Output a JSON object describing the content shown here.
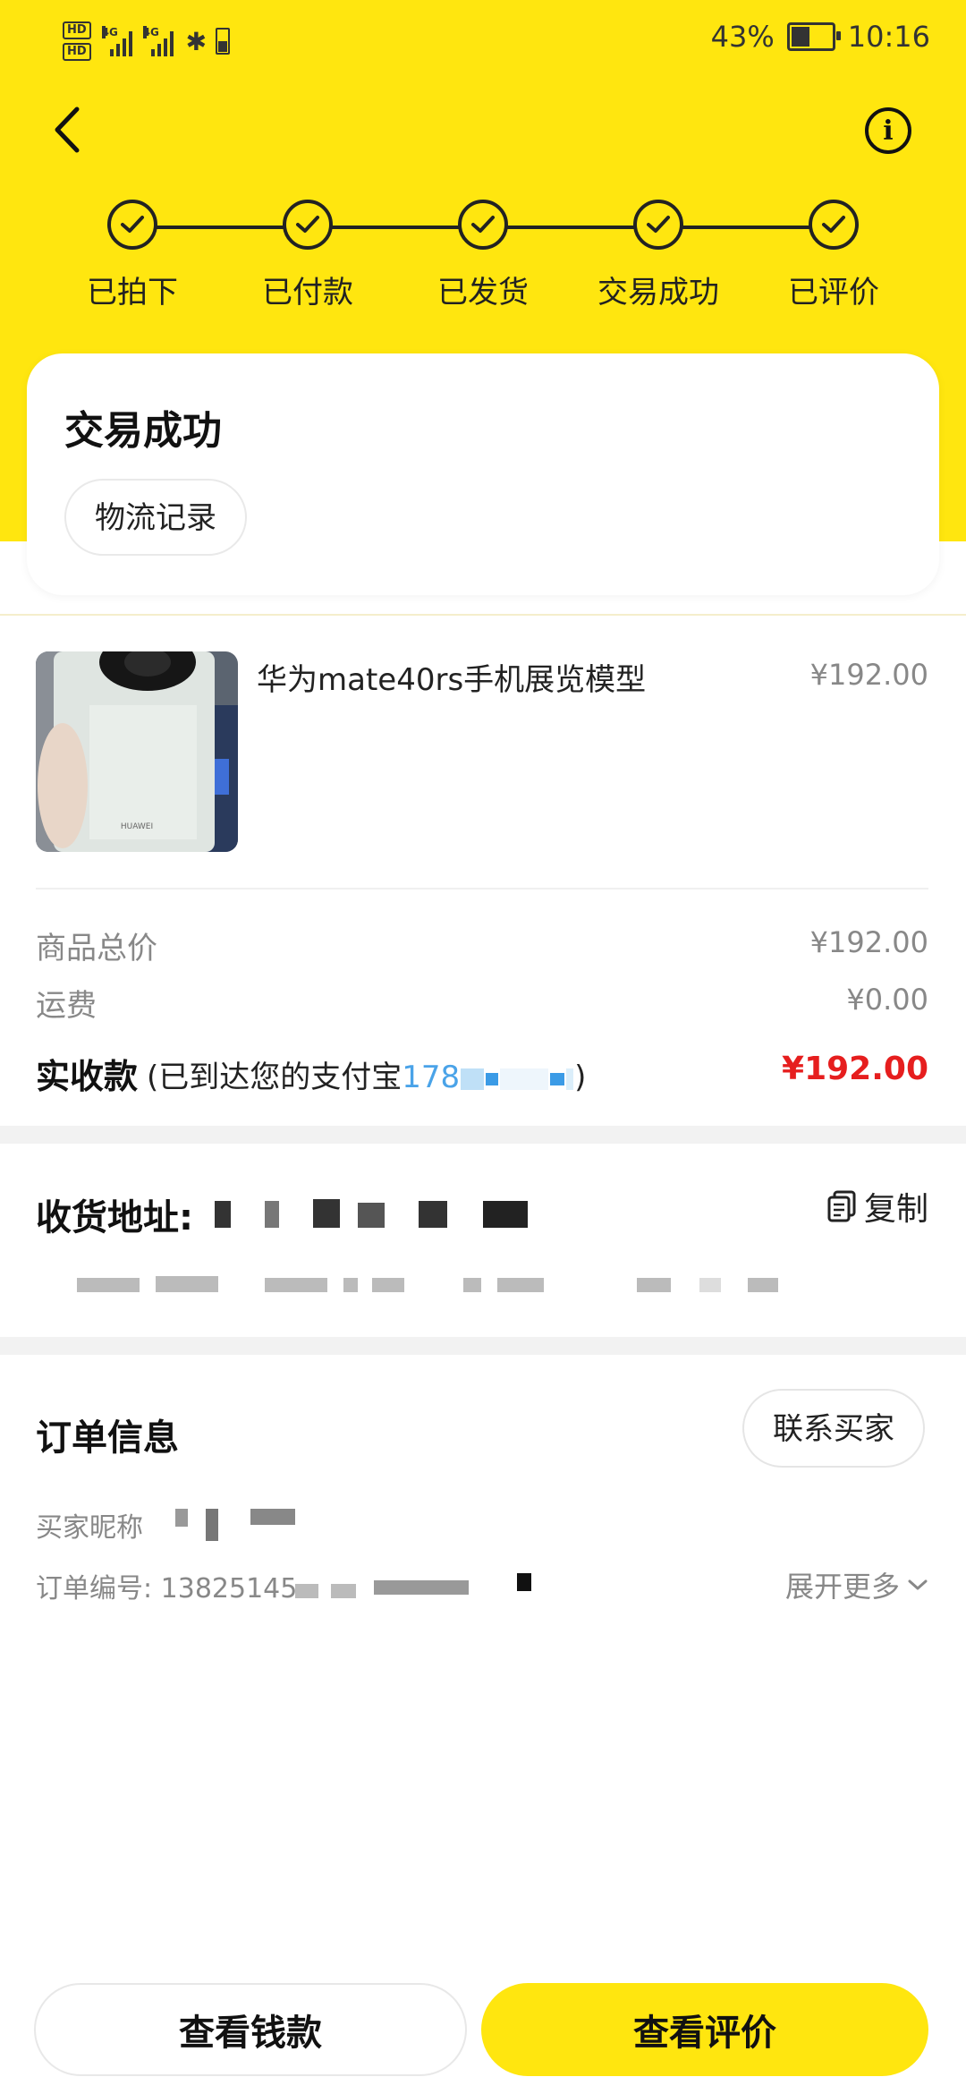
{
  "status_bar": {
    "hd1": "HD",
    "hd2": "HD",
    "net1": "4G",
    "net2": "4G",
    "battery_percent": "43%",
    "battery_level": 0.43,
    "time": "10:16"
  },
  "icons": {
    "back": "chevron-left-icon",
    "info": "info-icon",
    "check": "check-circle-icon",
    "copy": "copy-icon",
    "expand": "chevron-down-icon"
  },
  "colors": {
    "brand_yellow": "#FFE60F",
    "price_red": "#E61E1E"
  },
  "header": {
    "info_glyph": "i"
  },
  "steps": [
    {
      "label": "已拍下",
      "done": true
    },
    {
      "label": "已付款",
      "done": true
    },
    {
      "label": "已发货",
      "done": true
    },
    {
      "label": "交易成功",
      "done": true
    },
    {
      "label": "已评价",
      "done": true
    }
  ],
  "status_card": {
    "title": "交易成功",
    "logistics_button": "物流记录"
  },
  "product": {
    "name": "华为mate40rs手机展览模型",
    "price": "¥192.00",
    "image_brand_text": "HUAWEI"
  },
  "price_summary": {
    "total_label": "商品总价",
    "total_value": "¥192.00",
    "shipping_label": "运费",
    "shipping_value": "¥0.00",
    "actual_label": "实收款",
    "actual_note_prefix": "(已到达您的支付宝",
    "actual_note_partial": "178",
    "actual_note_suffix": ")",
    "actual_value": "¥192.00"
  },
  "address": {
    "label": "收货地址:",
    "copy_label": "复制"
  },
  "order_info": {
    "title": "订单信息",
    "contact_button": "联系买家",
    "buyer_nickname_label": "买家昵称",
    "order_number_label": "订单编号:",
    "order_number_partial": "13825145",
    "expand_label": "展开更多"
  },
  "bottom_bar": {
    "view_money": "查看钱款",
    "view_review": "查看评价"
  }
}
